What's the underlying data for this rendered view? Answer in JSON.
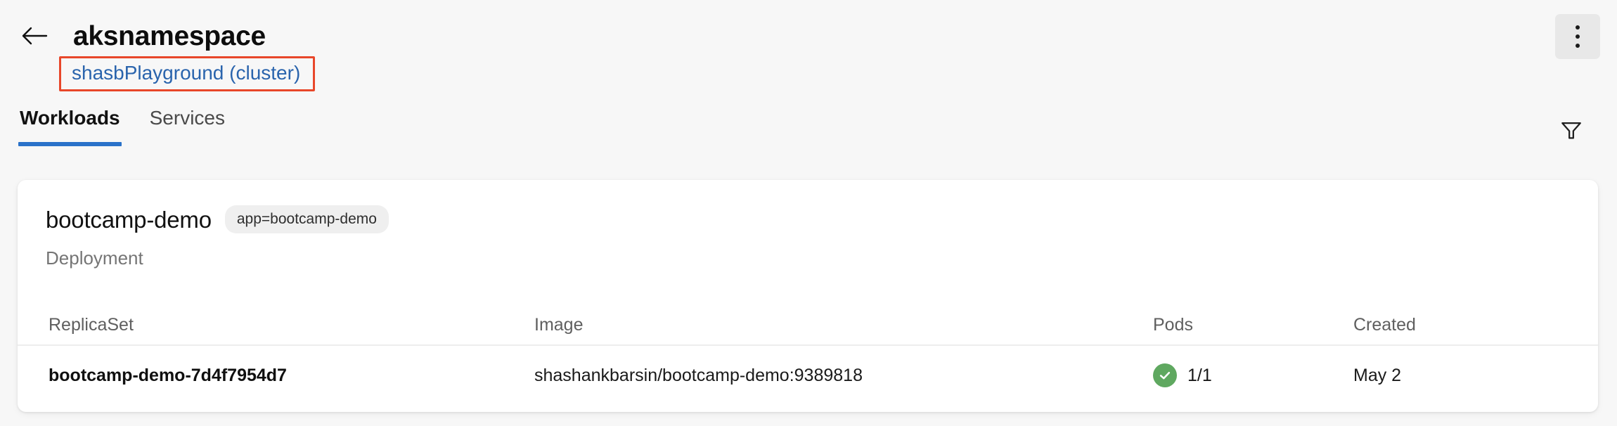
{
  "header": {
    "back_icon": "arrow-left-icon",
    "title": "aksnamespace",
    "cluster_link": "shasbPlayground (cluster)",
    "cluster_link_color": "#2a64ad",
    "annotation_box_color": "#e8472a",
    "overflow_menu_icon": "more-vertical-icon"
  },
  "tabs": {
    "items": [
      {
        "label": "Workloads",
        "active": true
      },
      {
        "label": "Services",
        "active": false
      }
    ],
    "active_underline_color": "#2a72c9",
    "filter_icon": "filter-funnel-icon"
  },
  "card": {
    "title": "bootcamp-demo",
    "badge": "app=bootcamp-demo",
    "subtitle": "Deployment",
    "table": {
      "columns": [
        "ReplicaSet",
        "Image",
        "Pods",
        "Created"
      ],
      "rows": [
        {
          "replicaset": "bootcamp-demo-7d4f7954d7",
          "image": "shashankbarsin/bootcamp-demo:9389818",
          "pods": "1/1",
          "pods_status_icon": "check-circle-icon",
          "pods_status_color": "#5fa860",
          "created": "May 2"
        }
      ]
    }
  }
}
